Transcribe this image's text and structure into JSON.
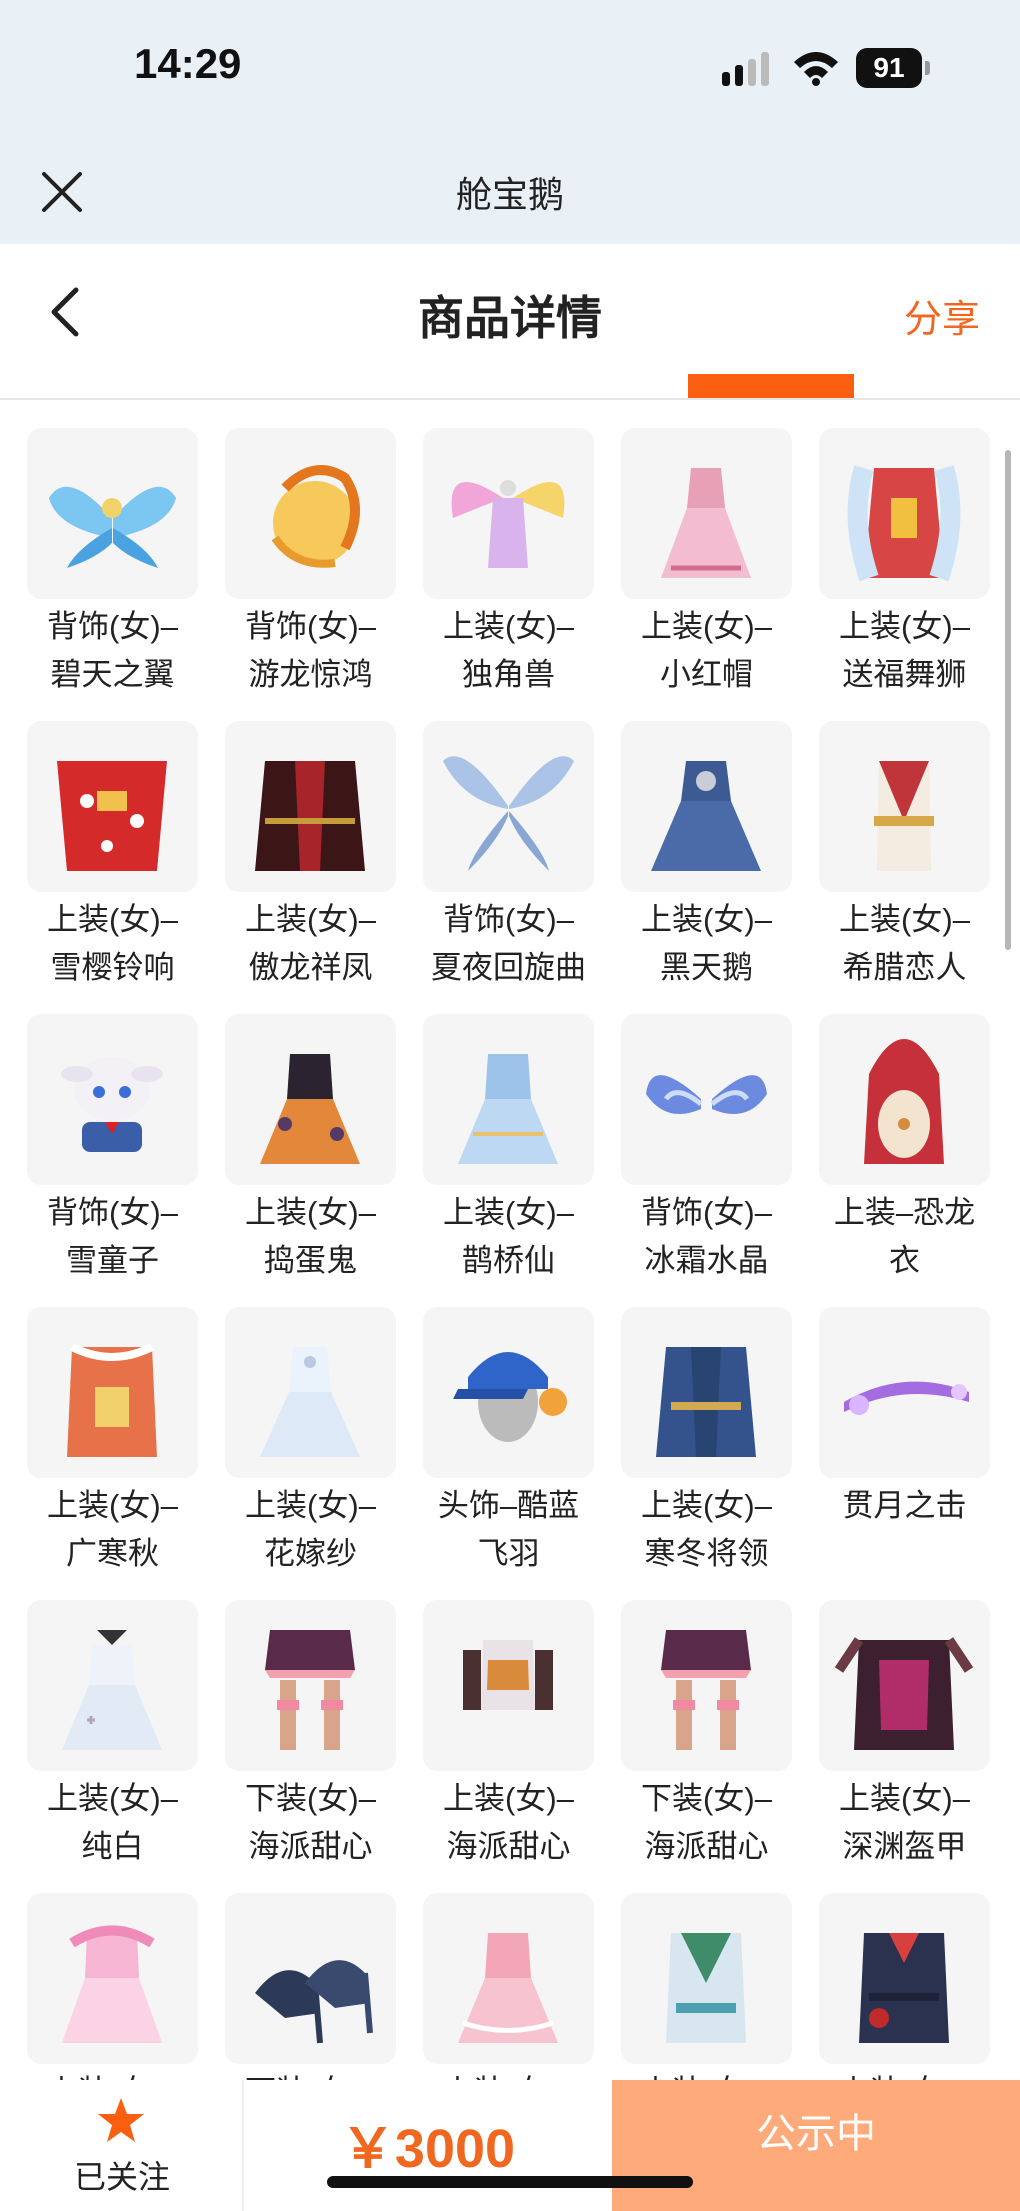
{
  "status": {
    "time": "14:29",
    "battery": "91"
  },
  "header": {
    "app_title": "舱宝鹅"
  },
  "nav": {
    "title": "商品详情",
    "share": "分享"
  },
  "items": [
    {
      "name": "背饰(女)–\n碧天之翼",
      "icon": "blue-wings"
    },
    {
      "name": "背饰(女)–\n游龙惊鸿",
      "icon": "golden-dragon"
    },
    {
      "name": "上装(女)–\n独角兽",
      "icon": "rainbow-wing-outfit"
    },
    {
      "name": "上装(女)–\n小红帽",
      "icon": "pink-dress"
    },
    {
      "name": "上装(女)–\n送福舞狮",
      "icon": "lion-dance-outfit"
    },
    {
      "name": "上装(女)–\n雪樱铃响",
      "icon": "red-kimono"
    },
    {
      "name": "上装(女)–\n傲龙祥凤",
      "icon": "dark-red-robe"
    },
    {
      "name": "背饰(女)–\n夏夜回旋曲",
      "icon": "fairy-wings"
    },
    {
      "name": "上装(女)–\n黑天鹅",
      "icon": "blue-gown"
    },
    {
      "name": "上装(女)–\n希腊恋人",
      "icon": "greek-outfit"
    },
    {
      "name": "背饰(女)–\n雪童子",
      "icon": "snow-bunny"
    },
    {
      "name": "上装(女)–\n捣蛋鬼",
      "icon": "halloween-dress"
    },
    {
      "name": "上装(女)–\n鹊桥仙",
      "icon": "light-blue-dress"
    },
    {
      "name": "背饰(女)–\n冰霜水晶",
      "icon": "ice-wings"
    },
    {
      "name": "上装–恐龙\n衣",
      "icon": "dino-suit"
    },
    {
      "name": "上装(女)–\n广寒秋",
      "icon": "autumn-outfit"
    },
    {
      "name": "上装(女)–\n花嫁纱",
      "icon": "white-wedding-dress"
    },
    {
      "name": "头饰–酷蓝\n飞羽",
      "icon": "blue-cap"
    },
    {
      "name": "上装(女)–\n寒冬将领",
      "icon": "winter-general"
    },
    {
      "name": "贯月之击",
      "icon": "purple-weapon"
    },
    {
      "name": "上装(女)–\n纯白",
      "icon": "white-dress"
    },
    {
      "name": "下装(女)–\n海派甜心",
      "icon": "pink-skirt"
    },
    {
      "name": "上装(女)–\n海派甜心",
      "icon": "sweet-top"
    },
    {
      "name": "下装(女)–\n海派甜心",
      "icon": "pink-skirt"
    },
    {
      "name": "上装(女)–\n深渊盔甲",
      "icon": "abyss-armor"
    },
    {
      "name": "上装(女)–",
      "icon": "pink-princess"
    },
    {
      "name": "下装(女)–",
      "icon": "navy-heels"
    },
    {
      "name": "上装(女)–",
      "icon": "pink-frill-dress"
    },
    {
      "name": "上装(女)–",
      "icon": "green-outfit"
    },
    {
      "name": "上装(女)–",
      "icon": "navy-uniform"
    }
  ],
  "bottom": {
    "follow_label": "已关注",
    "price": "￥3000",
    "action": "公示中"
  },
  "colors": {
    "accent": "#f0671f",
    "tab": "#f95e11",
    "action_bg": "#ffaa7a"
  }
}
